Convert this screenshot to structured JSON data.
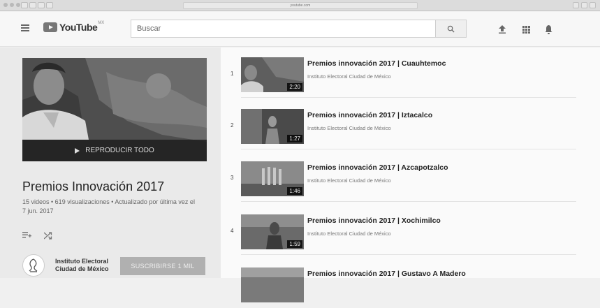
{
  "browser": {
    "url": "youtube.com"
  },
  "header": {
    "logo_text": "YouTube",
    "logo_country": "MX",
    "search_placeholder": "Buscar"
  },
  "playlist": {
    "play_all_label": "REPRODUCIR TODO",
    "title": "Premios Innovación 2017",
    "meta": "15 videos • 619 visualizaciones • Actualizado por última vez el 7 jun. 2017",
    "channel_name": "Instituto Electoral Ciudad de México",
    "subscribe_label": "SUSCRIBIRSE",
    "subscriber_count": "1 MIL"
  },
  "videos": [
    {
      "index": "1",
      "title": "Premios innovación 2017 | Cuauhtemoc",
      "channel": "Instituto Electoral Ciudad de México",
      "duration": "2:20"
    },
    {
      "index": "2",
      "title": "Premios innovación 2017 | Iztacalco",
      "channel": "Instituto Electoral Ciudad de México",
      "duration": "1:27"
    },
    {
      "index": "3",
      "title": "Premios innovación 2017 | Azcapotzalco",
      "channel": "Instituto Electoral Ciudad de México",
      "duration": "1:46"
    },
    {
      "index": "4",
      "title": "Premios innovación 2017 | Xochimilco",
      "channel": "Instituto Electoral Ciudad de México",
      "duration": "1:59"
    },
    {
      "index": "",
      "title": "Premios innovación 2017 | Gustavo A Madero",
      "channel": "",
      "duration": ""
    }
  ],
  "icons": [
    "menu-icon",
    "search-icon",
    "upload-icon",
    "apps-icon",
    "bell-icon",
    "add-to-queue-icon",
    "shuffle-icon",
    "channel-logo-icon",
    "play-icon"
  ]
}
